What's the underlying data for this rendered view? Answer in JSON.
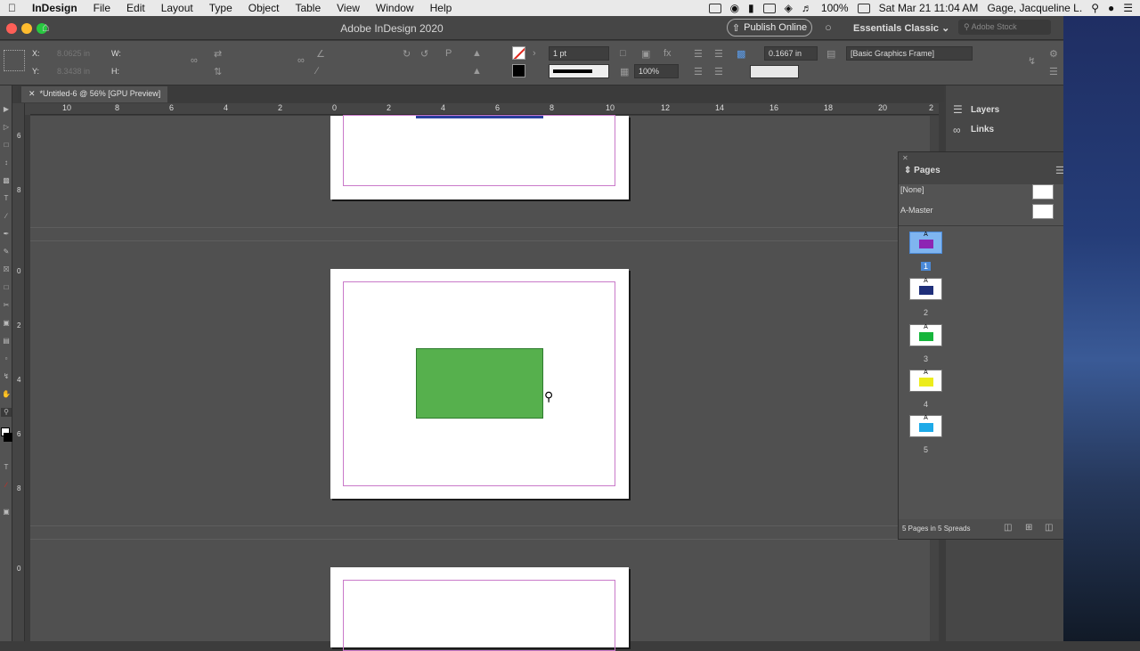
{
  "menubar": {
    "app_name": "InDesign",
    "items": [
      "File",
      "Edit",
      "Layout",
      "Type",
      "Object",
      "Table",
      "View",
      "Window",
      "Help"
    ],
    "battery": "100%",
    "datetime": "Sat Mar 21  11:04 AM",
    "user": "Gage, Jacqueline L."
  },
  "titlebar": {
    "title": "Adobe InDesign 2020",
    "publish_label": "Publish Online",
    "workspace": "Essentials Classic",
    "stock_placeholder": "Adobe Stock"
  },
  "control": {
    "x_label": "X:",
    "x_value": "8.0625 in",
    "y_label": "Y:",
    "y_value": "8.3438 in",
    "w_label": "W:",
    "h_label": "H:",
    "stroke_weight": "1 pt",
    "scale": "100%",
    "offset": "0.1667 in",
    "object_style": "[Basic Graphics Frame]"
  },
  "document": {
    "tab_label": "*Untitled-6 @ 56% [GPU Preview]",
    "ruler_labels": [
      "10",
      "8",
      "6",
      "4",
      "2",
      "0",
      "2",
      "4",
      "6",
      "8",
      "10",
      "12",
      "14",
      "16",
      "18",
      "20",
      "2"
    ],
    "vruler_labels": [
      "6",
      "8",
      "0",
      "2",
      "4",
      "6",
      "8",
      "0"
    ],
    "rect_color": "#56b04d"
  },
  "panels": {
    "layers": "Layers",
    "links": "Links",
    "pages_title": "Pages",
    "none_master": "[None]",
    "a_master": "A-Master",
    "pages": [
      {
        "number": "1",
        "master": "A",
        "color": "#8d25b3",
        "selected": true
      },
      {
        "number": "2",
        "master": "A",
        "color": "#1f2f7a",
        "selected": false
      },
      {
        "number": "3",
        "master": "A",
        "color": "#17b53c",
        "selected": false
      },
      {
        "number": "4",
        "master": "A",
        "color": "#ecec1b",
        "selected": false
      },
      {
        "number": "5",
        "master": "A",
        "color": "#1eaae8",
        "selected": false
      }
    ],
    "footer": "5 Pages in 5 Spreads"
  }
}
